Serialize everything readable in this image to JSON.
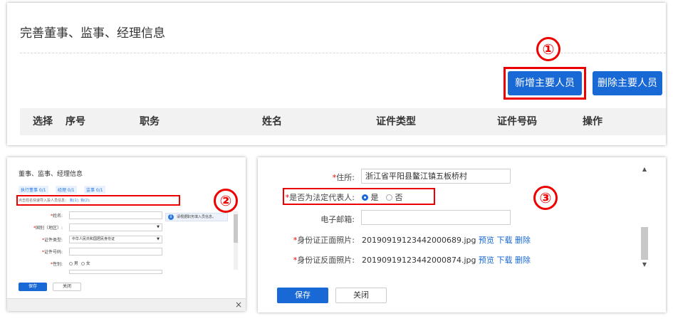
{
  "top_panel": {
    "title": "完善董事、监事、经理信息",
    "step_marker": "①",
    "add_button": "新增主要人员",
    "delete_button": "删除主要人员",
    "table_headers": [
      "选择",
      "序号",
      "职务",
      "姓名",
      "证件类型",
      "证件号码",
      "操作"
    ]
  },
  "bottom_left": {
    "step_marker": "②",
    "title": "董事、监事、经理信息",
    "tabs": [
      "执行董事 0/1",
      "经理 0/1",
      "监事 0/1"
    ],
    "import_text": "点击姓名快速导入投人员信息：",
    "import_links": [
      "我(1)",
      "我(2)"
    ],
    "info_text": "请根据职务填入员信息。",
    "fields": [
      {
        "label": "姓名:",
        "required": true,
        "value": ""
      },
      {
        "label": "国别（地区）:",
        "required": true,
        "value": ""
      },
      {
        "label": "证件类型:",
        "required": true,
        "value": "中华人民共和国居民身份证"
      },
      {
        "label": "证件号码:",
        "required": true,
        "value": ""
      },
      {
        "label": "性别:",
        "required": true,
        "value": ""
      }
    ],
    "gender_options": [
      "男",
      "女"
    ],
    "save_label": "保存",
    "close_label": "关闭",
    "close_icon": "×"
  },
  "bottom_right": {
    "step_marker": "③",
    "address_label": "住所:",
    "address_value": "浙江省平阳县鳌江镇五板桥村",
    "legal_rep_label": "是否为法定代表人:",
    "legal_rep_options": [
      "是",
      "否"
    ],
    "legal_rep_selected": "是",
    "email_label": "电子邮箱:",
    "email_value": "",
    "id_front_label": "身份证正面照片:",
    "id_front_file": "20190919123442000689.jpg",
    "id_back_label": "身份证反面照片:",
    "id_back_file": "20190919123442000874.jpg",
    "file_actions": [
      "预览",
      "下载",
      "删除"
    ],
    "save_label": "保存",
    "close_label": "关闭"
  },
  "colors": {
    "primary": "#1868d6",
    "annotation_red": "#e00000",
    "required_star": "#e00000"
  }
}
